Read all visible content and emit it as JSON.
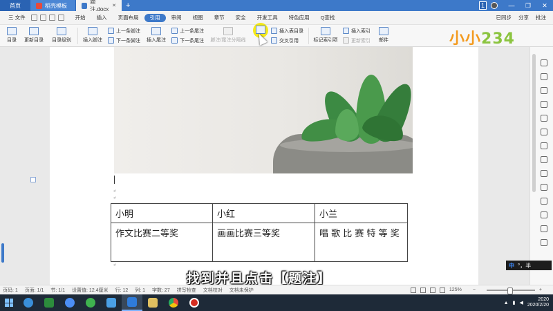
{
  "tabs": {
    "home": "首页",
    "template": "稻壳模板",
    "doc": "题注.docx",
    "add": "+"
  },
  "window": {
    "badge": "1"
  },
  "menubar": {
    "file": "三 文件",
    "items": [
      "开始",
      "插入",
      "页面布局",
      "引用",
      "审阅",
      "视图",
      "章节",
      "安全",
      "开发工具",
      "特色应用"
    ],
    "search": "Q查找",
    "sync": "已同步",
    "share": "分享",
    "comment": "批注"
  },
  "ribbon": {
    "toc": "目录",
    "update_toc": "更新目录",
    "toc_level": "目录级别",
    "insert_footnote": "插入脚注",
    "prev_footnote": "上一条脚注",
    "next_footnote": "下一条脚注",
    "insert_endnote": "插入尾注",
    "prev_endnote": "上一条尾注",
    "next_endnote": "下一条尾注",
    "footnote_sep": "脚注/尾注分隔线",
    "insert_toc_table": "插入表目录",
    "cross_ref": "交叉引用",
    "mark_index": "标记索引项",
    "insert_index": "插入索引",
    "update_index": "更新索引",
    "mail": "邮件"
  },
  "logo": {
    "part1": "小小",
    "part2": "234"
  },
  "table": {
    "header": [
      "小明",
      "小红",
      "小兰"
    ],
    "row": [
      "作文比赛二等奖",
      "画画比赛三等奖",
      "唱 歌 比 赛 特 等 奖"
    ]
  },
  "subtitle": "找到并且点击【题注】",
  "ime": {
    "lang": "中",
    "mode": "°，半"
  },
  "statusbar": {
    "page": "页码: 1",
    "pages": "页面: 1/1",
    "section": "节: 1/1",
    "position": "设置值: 12.4厘米",
    "line": "行: 12",
    "col": "列: 1",
    "wordcount": "字数: 27",
    "spellcheck": "拼写检查",
    "proofread": "文档校对",
    "protect": "文档未保护",
    "zoom": "125%"
  },
  "tray": {
    "time": "2020",
    "date": "2020/2/20"
  },
  "colors": {
    "accent": "#3d79c9",
    "highlight": "#f5e800",
    "logo_orange": "#f39a1e",
    "logo_green": "#8bc43f"
  }
}
